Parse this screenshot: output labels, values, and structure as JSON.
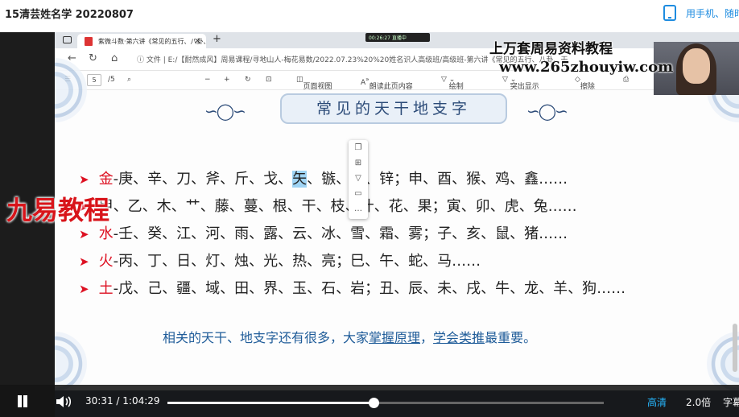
{
  "header": {
    "title": "15清芸姓名学 20220807",
    "mobile_label": "用手机、随时"
  },
  "browser": {
    "tab_title": "紫微斗数·第六讲《常见的五行、八卦、干",
    "url": "ⓘ 文件 | E:/【耐然成风】周易课程/寻地山人-梅花易数/2022.07.23%20%20姓名识人高级班/高级班-第六讲《常见的五行、八卦、干",
    "rec_text": "00:26:27 直播中"
  },
  "pdf_toolbar": {
    "page_current": "5",
    "page_total": "/5",
    "page_view": "页面视图",
    "read_aloud": "朗读此页内容",
    "draw": "绘制",
    "highlight": "突出显示",
    "erase": "擦除"
  },
  "page": {
    "heading": "常见的天干地支字",
    "rows": [
      {
        "element": "金",
        "text": "-庚、辛、刀、斧、斤、戈、",
        "highlight": "矢",
        "rest": "、镞、新、锌；申、酉、猴、鸡、鑫……"
      },
      {
        "element": "",
        "text": "甲、乙、木、艹、藤、蔓、根、干、枝、叶、花、果；寅、卯、虎、兔……",
        "highlight": "",
        "rest": ""
      },
      {
        "element": "水",
        "text": "-壬、癸、江、河、雨、露、云、冰、雪、霜、雾；子、亥、鼠、猪……",
        "highlight": "",
        "rest": ""
      },
      {
        "element": "火",
        "text": "-丙、丁、日、灯、烛、光、热、亮；巳、午、蛇、马……",
        "highlight": "",
        "rest": ""
      },
      {
        "element": "土",
        "text": "-戊、己、疆、域、田、界、玉、石、岩；丑、辰、未、戌、牛、龙、羊、狗……",
        "highlight": "",
        "rest": ""
      }
    ],
    "footer": {
      "part1": "相关的天干、地支字还有很多，大家",
      "link1": "掌握原理",
      "part2": "，",
      "link2": "学会类推",
      "part3": "最重要。"
    }
  },
  "watermarks": {
    "line1": "上万套周易资料教程",
    "line2": "www.265zhouyiw.com",
    "left": "九易教程"
  },
  "player": {
    "current_time": "30:31",
    "separator": "/",
    "duration": "1:04:29",
    "progress": 0.473,
    "quality": "高清",
    "speed": "2.0倍",
    "subtitle": "字幕"
  }
}
